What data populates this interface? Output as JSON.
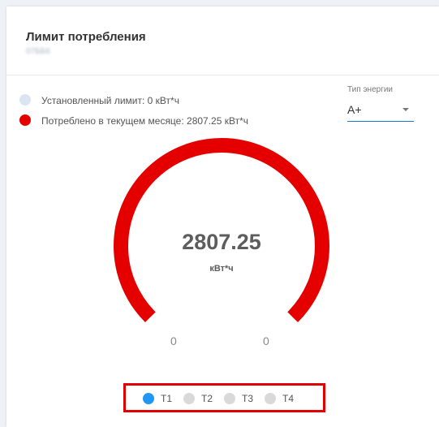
{
  "card": {
    "title": "Лимит потребления",
    "subtitle": "07ББ6"
  },
  "legend": [
    {
      "label": "Установленный лимит: 0 кВт*ч",
      "color": "#dbe5f2"
    },
    {
      "label": "Потреблено в текущем месяце: 2807.25 кВт*ч",
      "color": "#e50000"
    }
  ],
  "energy_type": {
    "label": "Тип энергии",
    "value": "А+",
    "accent": "#1976d2"
  },
  "gauge": {
    "value": "2807.25",
    "unit": "кВт*ч",
    "min_label": "0",
    "max_label": "0",
    "limit": 0,
    "consumed": 2807.25,
    "fill_fraction": 1.0,
    "arc_color": "#e50000"
  },
  "tariffs": [
    {
      "label": "T1",
      "selected": true,
      "color": "#2196f3"
    },
    {
      "label": "T2",
      "selected": false,
      "color": "#d9d9d9"
    },
    {
      "label": "T3",
      "selected": false,
      "color": "#d9d9d9"
    },
    {
      "label": "T4",
      "selected": false,
      "color": "#d9d9d9"
    }
  ]
}
